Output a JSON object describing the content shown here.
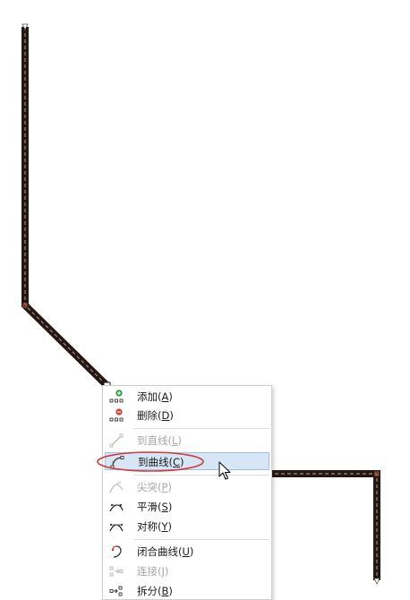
{
  "context_menu": {
    "items": [
      {
        "label": "添加",
        "accel": "A",
        "icon": "add-node-icon",
        "enabled": true
      },
      {
        "label": "删除",
        "accel": "D",
        "icon": "delete-node-icon",
        "enabled": true
      },
      {
        "label": "到直线",
        "accel": "L",
        "icon": "to-line-icon",
        "enabled": false
      },
      {
        "label": "到曲线",
        "accel": "C",
        "icon": "to-curve-icon",
        "enabled": true,
        "highlighted": true
      },
      {
        "label": "尖突",
        "accel": "P",
        "icon": "cusp-icon",
        "enabled": false
      },
      {
        "label": "平滑",
        "accel": "S",
        "icon": "smooth-icon",
        "enabled": true
      },
      {
        "label": "对称",
        "accel": "Y",
        "icon": "symmetrical-icon",
        "enabled": true
      },
      {
        "label": "闭合曲线",
        "accel": "U",
        "icon": "close-curve-icon",
        "enabled": true
      },
      {
        "label": "连接",
        "accel": "J",
        "icon": "join-icon",
        "enabled": false
      },
      {
        "label": "拆分",
        "accel": "B",
        "icon": "break-apart-icon",
        "enabled": true
      }
    ]
  },
  "colors": {
    "path_fill": "#231815",
    "path_dash": "#c9a890",
    "node_marker": "#e36a3a",
    "annotation_ellipse": "#d03a3a",
    "menu_highlight": "#d7e6f6"
  }
}
